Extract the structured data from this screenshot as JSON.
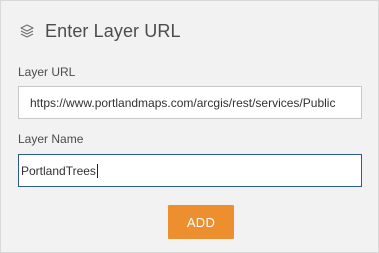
{
  "header": {
    "icon": "layers-icon",
    "title": "Enter Layer URL"
  },
  "layer_url": {
    "label": "Layer URL",
    "value": "https://www.portlandmaps.com/arcgis/rest/services/Public"
  },
  "layer_name": {
    "label": "Layer Name",
    "value": "PortlandTrees"
  },
  "actions": {
    "add_label": "ADD",
    "add_color": "#ed8f2f"
  }
}
